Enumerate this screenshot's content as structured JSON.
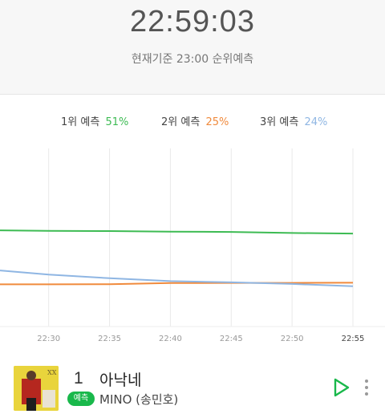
{
  "header": {
    "clock": "22:59:03",
    "subtitle": "현재기준 23:00 순위예측"
  },
  "legend": [
    {
      "label": "1위 예측",
      "pct": "51%",
      "color": "#3dbb53"
    },
    {
      "label": "2위 예측",
      "pct": "25%",
      "color": "#f08a3c"
    },
    {
      "label": "3위 예측",
      "pct": "24%",
      "color": "#8fb6e3"
    }
  ],
  "chart_data": {
    "type": "line",
    "x": [
      "22:30",
      "22:35",
      "22:40",
      "22:45",
      "22:50",
      "22:55"
    ],
    "xlim": [
      "22:26",
      "22:55"
    ],
    "ylim": [
      0,
      100
    ],
    "grid": "vertical",
    "series": [
      {
        "name": "1위 예측",
        "color": "#3dbb53",
        "points": [
          [
            "22:26",
            54
          ],
          [
            "22:30",
            53.7
          ],
          [
            "22:35",
            53.6
          ],
          [
            "22:40",
            53.3
          ],
          [
            "22:45",
            53.1
          ],
          [
            "22:50",
            52.5
          ],
          [
            "22:55",
            52.2
          ]
        ]
      },
      {
        "name": "2위 예측",
        "color": "#f08a3c",
        "points": [
          [
            "22:26",
            23.7
          ],
          [
            "22:30",
            23.7
          ],
          [
            "22:35",
            23.8
          ],
          [
            "22:40",
            24.4
          ],
          [
            "22:45",
            24.5
          ],
          [
            "22:50",
            24.5
          ],
          [
            "22:55",
            24.6
          ]
        ]
      },
      {
        "name": "3위 예측",
        "color": "#8fb6e3",
        "points": [
          [
            "22:26",
            31.5
          ],
          [
            "22:30",
            29.2
          ],
          [
            "22:35",
            27.1
          ],
          [
            "22:40",
            25.5
          ],
          [
            "22:45",
            24.8
          ],
          [
            "22:50",
            23.9
          ],
          [
            "22:55",
            22.6
          ]
        ]
      }
    ]
  },
  "track": {
    "rank": "1",
    "title": "아낙네",
    "badge": "예측",
    "artist": "MINO (송민호)",
    "album_art_text": "XX"
  },
  "icons": {
    "play": "play-icon",
    "more": "more-vertical-icon"
  },
  "colors": {
    "accent": "#19b84b",
    "gridline": "#e9e9e9"
  }
}
